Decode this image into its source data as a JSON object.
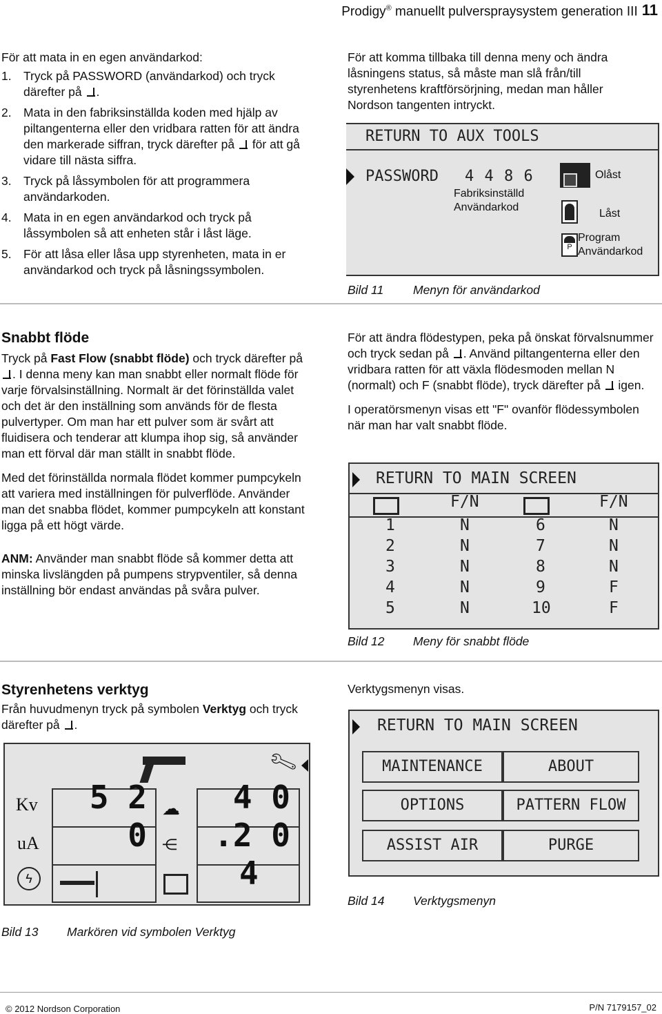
{
  "header": {
    "brand": "Prodigy",
    "reg": "®",
    "title": " manuellt pulverspraysystem generation III",
    "page": "11"
  },
  "password_section": {
    "intro": "För att mata in en egen användarkod:",
    "steps": [
      {
        "num": "1.",
        "text": "Tryck på PASSWORD (användarkod) och tryck därefter på",
        "after": "."
      },
      {
        "num": "2.",
        "text": "Mata in den fabriksinställda koden med hjälp av piltangenterna eller den vridbara ratten för att ändra den markerade siffran, tryck därefter på",
        "after": " för att gå vidare till nästa siffra."
      },
      {
        "num": "3.",
        "text": "Tryck på låssymbolen för att programmera användarkoden."
      },
      {
        "num": "4.",
        "text": "Mata in en egen användarkod och tryck på låssymbolen så att enheten står i låst läge."
      },
      {
        "num": "5.",
        "text": "För att låsa eller låsa upp styrenheten, mata in er användarkod och tryck på låsningssymbolen."
      }
    ],
    "right_text": "För att komma tillbaka till denna meny och ändra låsningens status, så måste man slå från/till styrenhetens kraftförsörjning, medan man håller Nordson tangenten intryckt."
  },
  "fig11": {
    "header": "RETURN TO AUX TOOLS",
    "row_label": "PASSWORD",
    "code": "4 4 8 6",
    "code_note_1": "Fabriksinställd",
    "code_note_2": "Användarkod",
    "unlocked": "Olåst",
    "locked": "Låst",
    "program_1": "Program",
    "program_2": "Användarkod",
    "caption_num": "Bild 11",
    "caption": "Menyn för användarkod"
  },
  "fastflow": {
    "heading": "Snabbt flöde",
    "p1_a": "Tryck på ",
    "p1_bold": "Fast Flow (snabbt flöde)",
    "p1_b": " och tryck därefter på",
    "p1_c": ". I denna meny kan man snabbt eller normalt flöde för varje förvalsinställning. Normalt är det förinställda valet och det är den inställning som används för de flesta pulvertyper. Om man har ett pulver som är svårt att fluidisera och tenderar att klumpa ihop sig, så använder man ett förval där man ställt in snabbt flöde.",
    "p2": "Med det förinställda normala flödet kommer pumpcykeln att variera med inställningen för pulverflöde. Använder man det snabba flödet, kommer pumpcykeln att konstant ligga på ett högt värde.",
    "note_label": "ANM:",
    "note": " Använder man snabbt flöde så kommer detta att minska livslängden på pumpens strypventiler, så denna inställning bör endast användas på svåra pulver.",
    "r1_a": "För att ändra flödestypen, peka på önskat förvalsnummer och tryck sedan på",
    "r1_b": ". Använd piltangenterna eller den vridbara ratten för att växla flödesmoden mellan N (normalt) och F (snabbt flöde), tryck därefter på",
    "r1_c": " igen.",
    "r2": "I operatörsmenyn visas ett \"F\" ovanför flödessymbolen när man har valt snabbt flöde."
  },
  "fig12": {
    "header": "RETURN TO MAIN SCREEN",
    "col_header": "F/N",
    "rows": [
      {
        "a": "1",
        "b": "N",
        "c": "6",
        "d": "N"
      },
      {
        "a": "2",
        "b": "N",
        "c": "7",
        "d": "N"
      },
      {
        "a": "3",
        "b": "N",
        "c": "8",
        "d": "N"
      },
      {
        "a": "4",
        "b": "N",
        "c": "9",
        "d": "F"
      },
      {
        "a": "5",
        "b": "N",
        "c": "10",
        "d": "F"
      }
    ],
    "caption_num": "Bild 12",
    "caption": "Meny för snabbt flöde"
  },
  "tools": {
    "heading": "Styrenhetens verktyg",
    "p_a": "Från huvudmenyn tryck på symbolen ",
    "p_bold": "Verktyg",
    "p_b": " och tryck därefter på",
    "p_c": ".",
    "r": "Verktygsmenyn visas."
  },
  "fig13": {
    "kv_label": "Kv",
    "ua_label": "uA",
    "kv_value": "5 2",
    "ua_value": "0",
    "air_value": "4 0",
    "flow_value": ".2 0",
    "preset_value": "4",
    "caption_num": "Bild 13",
    "caption": "Markören vid symbolen Verktyg"
  },
  "fig14": {
    "header": "RETURN TO MAIN SCREEN",
    "buttons": [
      "MAINTENANCE",
      "ABOUT",
      "OPTIONS",
      "PATTERN FLOW",
      "ASSIST AIR",
      "PURGE"
    ],
    "caption_num": "Bild 14",
    "caption": "Verktygsmenyn"
  },
  "footer": {
    "copyright": "© 2012 Nordson Corporation",
    "pn": "P/N 7179157_02"
  }
}
